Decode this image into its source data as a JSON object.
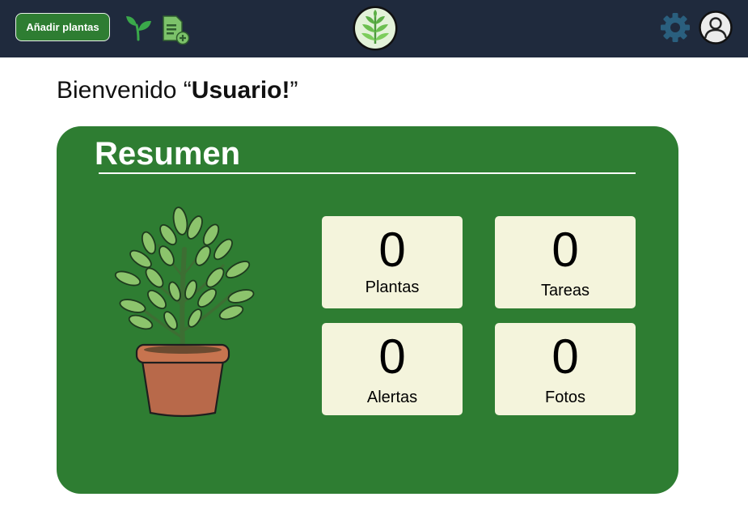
{
  "nav": {
    "add_button_label": "Añadir plantas",
    "icons": [
      "sprout-icon",
      "document-add-icon",
      "app-logo",
      "gear-icon",
      "user-avatar-icon"
    ]
  },
  "welcome": {
    "prefix": "Bienvenido “",
    "user": "Usuario!",
    "suffix": "”"
  },
  "summary": {
    "title": "Resumen",
    "stats": [
      {
        "value": "0",
        "label": "Plantas"
      },
      {
        "value": "0",
        "label": "Tareas"
      },
      {
        "value": "0",
        "label": "Alertas"
      },
      {
        "value": "0",
        "label": "Fotos"
      }
    ]
  },
  "colors": {
    "navbar": "#1f2a3d",
    "accent_green": "#2e7d32",
    "card_bg": "#f4f4dc",
    "gear": "#2a5f7e"
  }
}
